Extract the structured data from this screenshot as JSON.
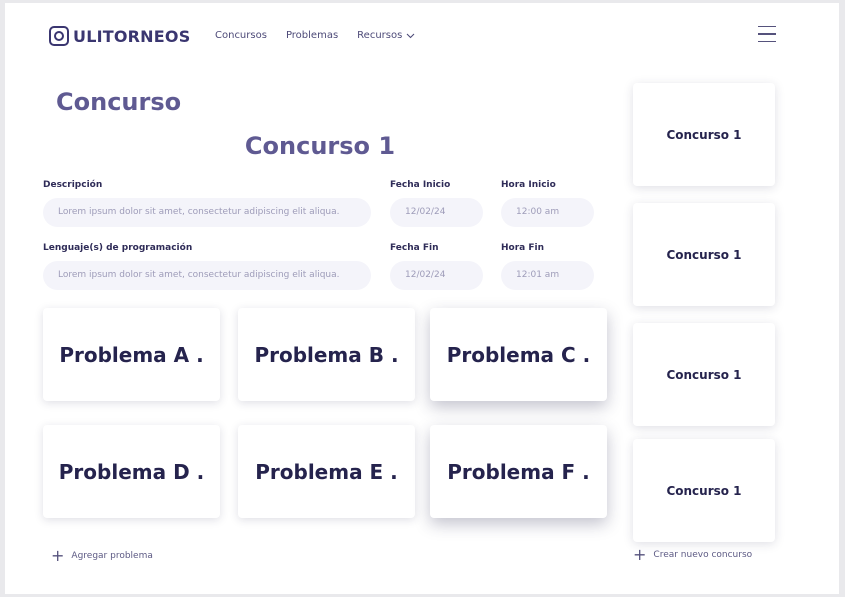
{
  "header": {
    "logo_text": "ULITORNEOS",
    "nav": [
      {
        "label": "Concursos"
      },
      {
        "label": "Problemas"
      },
      {
        "label": "Recursos"
      }
    ]
  },
  "page": {
    "title": "Concurso",
    "contest_name": "Concurso 1"
  },
  "form": {
    "description_label": "Descripción",
    "description_value": "Lorem ipsum dolor sit amet, consectetur adipiscing elit aliqua.",
    "languages_label": "Lenguaje(s) de programación",
    "languages_value": "Lorem ipsum dolor sit amet, consectetur adipiscing elit aliqua.",
    "start_date_label": "Fecha Inicio",
    "start_date_value": "12/02/24",
    "start_time_label": "Hora Inicio",
    "start_time_value": "12:00 am",
    "end_date_label": "Fecha Fin",
    "end_date_value": "12/02/24",
    "end_time_label": "Hora Fin",
    "end_time_value": "12:01 am"
  },
  "problems": [
    {
      "title": "Problema A ."
    },
    {
      "title": "Problema B ."
    },
    {
      "title": "Problema C ."
    },
    {
      "title": "Problema D ."
    },
    {
      "title": "Problema E ."
    },
    {
      "title": "Problema F ."
    }
  ],
  "add_problem_label": "Agregar problema",
  "sidebar": {
    "contests": [
      {
        "title": "Concurso 1"
      },
      {
        "title": "Concurso 1"
      },
      {
        "title": "Concurso 1"
      },
      {
        "title": "Concurso 1"
      }
    ],
    "create_label": "Crear nuevo concurso"
  }
}
